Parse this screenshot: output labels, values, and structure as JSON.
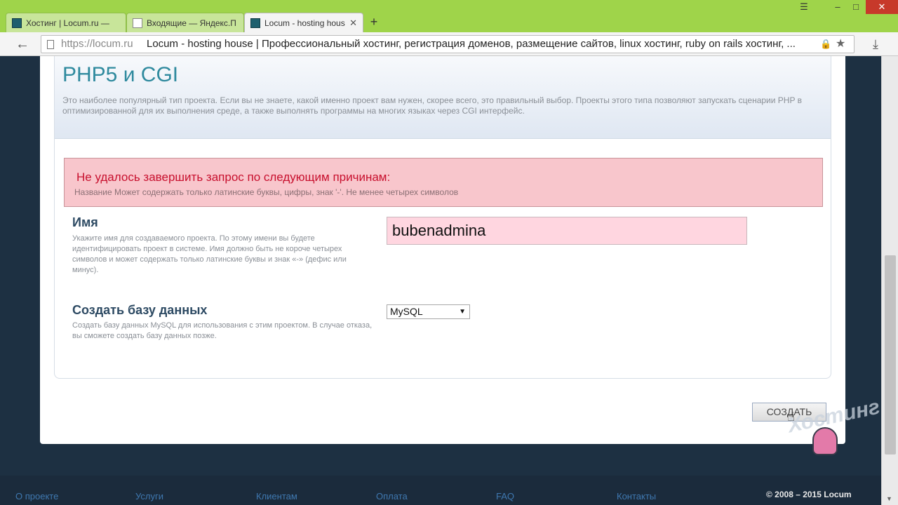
{
  "browser": {
    "tabs": [
      {
        "label": "Хостинг | Locum.ru —",
        "icon": "locum-favicon"
      },
      {
        "label": "Входящие — Яндекс.П",
        "icon": "mail-favicon"
      },
      {
        "label": "Locum - hosting hous",
        "icon": "locum-favicon"
      }
    ],
    "new_tab": "+",
    "url": "https://locum.ru",
    "page_title": "Locum - hosting house | Профессиональный хостинг, регистрация доменов, размещение сайтов, linux хостинг, ruby on rails хостинг, ..."
  },
  "project": {
    "title": "PHP5 и CGI",
    "description": "Это наиболее популярный тип проекта. Если вы не знаете, какой именно проект вам нужен, скорее всего, это правильный выбор. Проекты этого типа позволяют запускать сценарии PHP в оптимизированной для их выполнения среде, а также выполнять программы на многих языках через CGI интерфейс."
  },
  "error": {
    "title": "Не удалось завершить запрос по следующим причинам:",
    "message": "Название Может содержать только латинские буквы, цифры, знак '-'. Не менее четырех символов"
  },
  "form": {
    "name": {
      "label": "Имя",
      "help": "Укажите имя для создаваемого проекта. По этому имени вы будете идентифицировать проект в системе. Имя должно быть не короче четырех символов и может содержать только латинские буквы и знак «-» (дефис или минус).",
      "value": "bubenadmina"
    },
    "database": {
      "label": "Создать базу данных",
      "help": "Создать базу данных MySQL для использования с этим проектом. В случае отказа, вы сможете создать базу данных позже.",
      "selected": "MySQL"
    },
    "submit_label": "СОЗДАТЬ"
  },
  "footer": {
    "links": [
      "О проекте",
      "Услуги",
      "Клиентам",
      "Оплата",
      "FAQ",
      "Контакты"
    ],
    "copyright": "© 2008 – 2015 Locum"
  },
  "watermark": {
    "text": "Хостинг"
  },
  "colors": {
    "titlebar": "#9fd44a",
    "accent_title": "#2f8a9e",
    "error_bg": "#f8c6cc",
    "error_text": "#c8102e",
    "footer_link": "#3f78b0"
  }
}
